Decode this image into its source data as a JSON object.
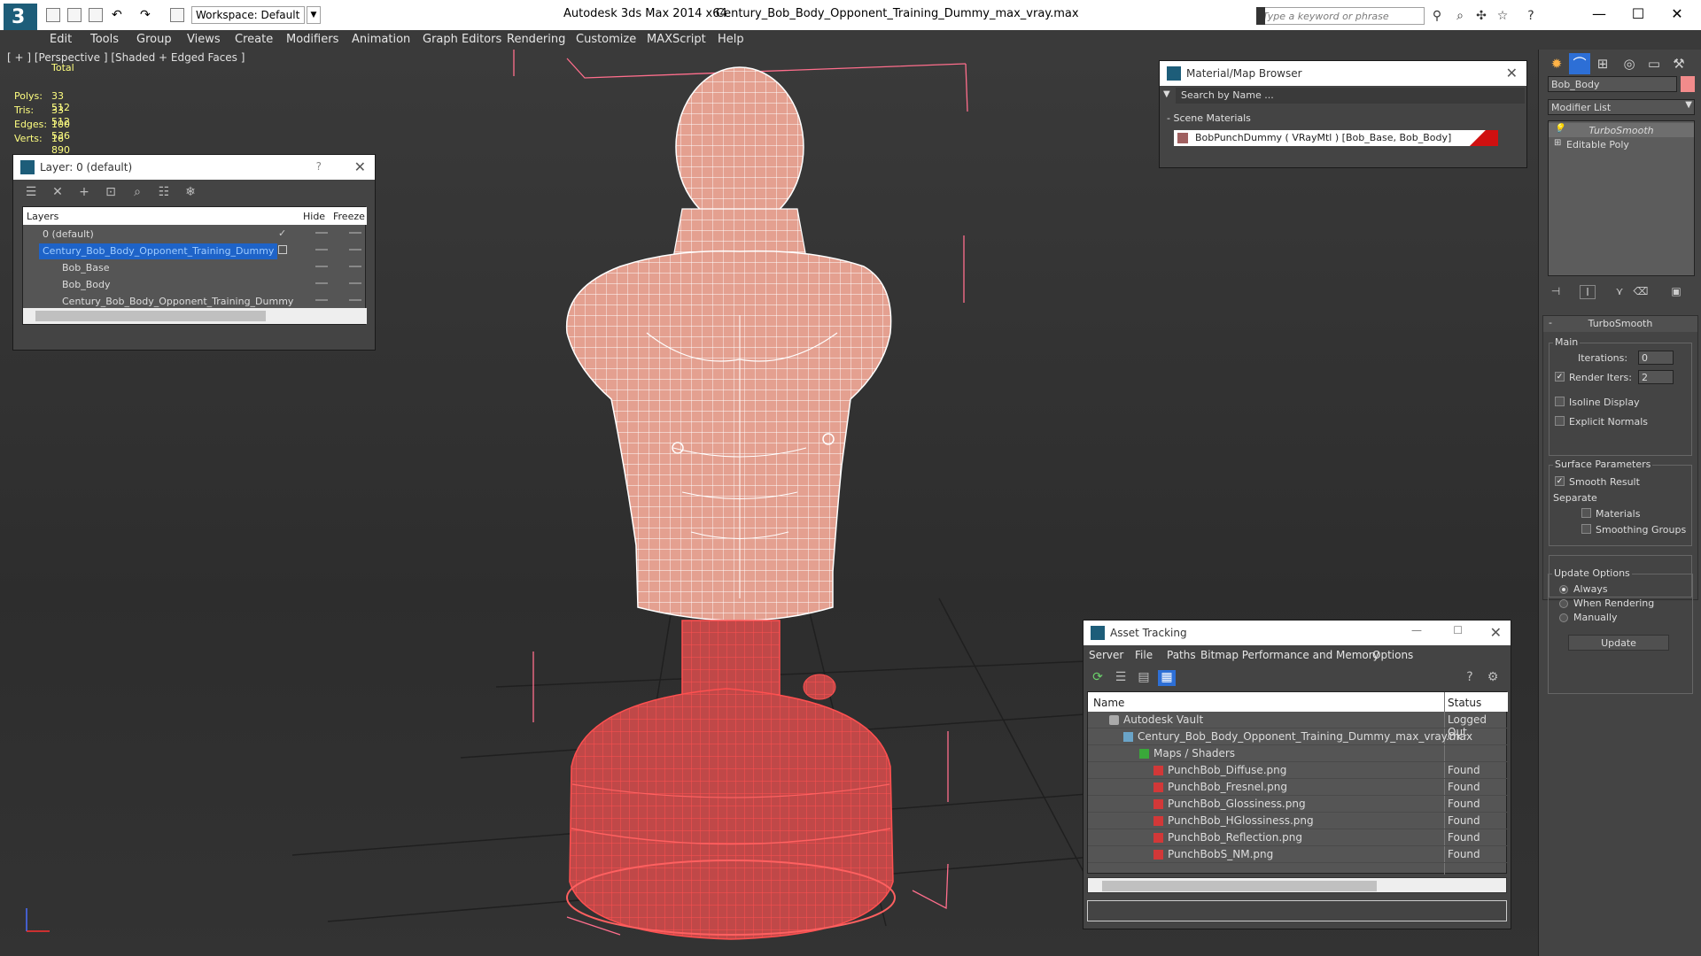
{
  "titlebar": {
    "workspace": "Workspace: Default",
    "app_title": "Autodesk 3ds Max  2014 x64",
    "file_title": "Century_Bob_Body_Opponent_Training_Dummy_max_vray.max",
    "search_placeholder": "Type a keyword or phrase"
  },
  "menubar": {
    "items": [
      "Edit",
      "Tools",
      "Group",
      "Views",
      "Create",
      "Modifiers",
      "Animation",
      "Graph Editors",
      "Rendering",
      "Customize",
      "MAXScript",
      "Help"
    ]
  },
  "viewport": {
    "label": "[ + ] [Perspective ] [Shaded + Edged Faces ]",
    "stats": {
      "total_label": "Total",
      "rows": [
        {
          "label": "Polys:",
          "value": "33 512"
        },
        {
          "label": "Tris:",
          "value": "33 512"
        },
        {
          "label": "Edges:",
          "value": "100 536"
        },
        {
          "label": "Verts:",
          "value": "16 890"
        }
      ]
    },
    "colors": {
      "mesh_fill": "#e8a595",
      "wire": "#ffffff",
      "base_wire": "#ff4d4d",
      "selection_box": "#ff6e8c"
    }
  },
  "layer_panel": {
    "title": "Layer: 0 (default)",
    "help": "?",
    "columns": {
      "layers": "Layers",
      "hide": "Hide",
      "freeze": "Freeze"
    },
    "rows": [
      {
        "name": "0 (default)",
        "selected": false,
        "level": 0
      },
      {
        "name": "Century_Bob_Body_Opponent_Training_Dummy",
        "selected": true,
        "level": 0
      },
      {
        "name": "Bob_Base",
        "selected": false,
        "level": 1
      },
      {
        "name": "Bob_Body",
        "selected": false,
        "level": 1
      },
      {
        "name": "Century_Bob_Body_Opponent_Training_Dummy",
        "selected": false,
        "level": 1
      }
    ]
  },
  "material_browser": {
    "title": "Material/Map Browser",
    "search_placeholder": "Search by Name ...",
    "section": "- Scene Materials",
    "material": "BobPunchDummy  ( VRayMtl ) [Bob_Base, Bob_Body]",
    "swatch_color": "#d01010"
  },
  "asset_tracking": {
    "title": "Asset Tracking",
    "menu": [
      "Server",
      "File",
      "Paths",
      "Bitmap Performance and Memory",
      "Options"
    ],
    "columns": {
      "name": "Name",
      "status": "Status"
    },
    "rows": [
      {
        "name": "Autodesk Vault",
        "status": "Logged Out",
        "indent": 0
      },
      {
        "name": "Century_Bob_Body_Opponent_Training_Dummy_max_vray.max",
        "status": "Ok",
        "indent": 1
      },
      {
        "name": "Maps / Shaders",
        "status": "",
        "indent": 2
      },
      {
        "name": "PunchBob_Diffuse.png",
        "status": "Found",
        "indent": 3
      },
      {
        "name": "PunchBob_Fresnel.png",
        "status": "Found",
        "indent": 3
      },
      {
        "name": "PunchBob_Glossiness.png",
        "status": "Found",
        "indent": 3
      },
      {
        "name": "PunchBob_HGlossiness.png",
        "status": "Found",
        "indent": 3
      },
      {
        "name": "PunchBob_Reflection.png",
        "status": "Found",
        "indent": 3
      },
      {
        "name": "PunchBobS_NM.png",
        "status": "Found",
        "indent": 3
      }
    ]
  },
  "command_panel": {
    "object_name": "Bob_Body",
    "object_color": "#f28b8b",
    "modifier_list": "Modifier List",
    "stack": [
      "TurboSmooth",
      "Editable Poly"
    ],
    "turbosmooth": {
      "title": "TurboSmooth",
      "main_label": "Main",
      "iterations_label": "Iterations:",
      "iterations": "0",
      "render_iters_label": "Render Iters:",
      "render_iters": "2",
      "isoline": "Isoline Display",
      "explicit_normals": "Explicit Normals",
      "surface_params": "Surface Parameters",
      "smooth_result": "Smooth Result",
      "separate": "Separate",
      "materials": "Materials",
      "smoothing_groups": "Smoothing Groups",
      "update_options": "Update Options",
      "always": "Always",
      "when_rendering": "When Rendering",
      "manually": "Manually",
      "update_button": "Update"
    }
  }
}
